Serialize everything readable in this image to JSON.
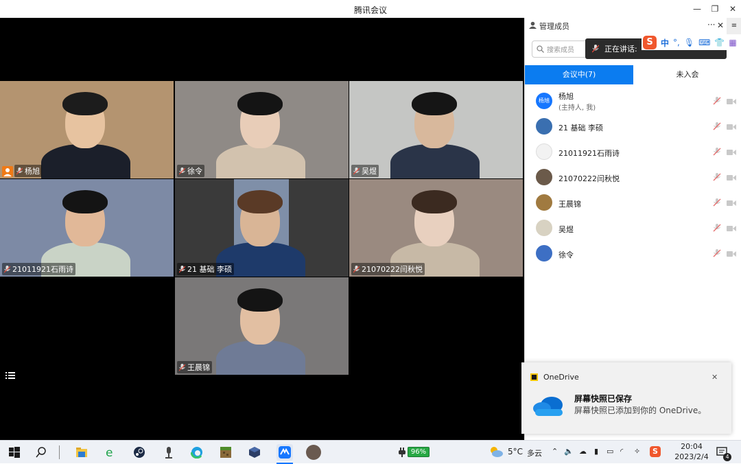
{
  "window": {
    "title": "腾讯会议"
  },
  "tiles": [
    {
      "name": "杨旭",
      "colors": {
        "bg": "#b49470",
        "skin": "#e7c3a0",
        "hair": "#1c1c1c",
        "cloth": "#1b1f2a"
      }
    },
    {
      "name": "徐令",
      "colors": {
        "bg": "#8f8a86",
        "skin": "#e8cdb8",
        "hair": "#141414",
        "cloth": "#d2c2ae"
      }
    },
    {
      "name": "吴煜",
      "colors": {
        "bg": "#c5c6c4",
        "skin": "#d8b89c",
        "hair": "#151515",
        "cloth": "#2a3448"
      }
    },
    {
      "name": "21011921石雨诗",
      "colors": {
        "bg": "#7d8aa5",
        "skin": "#e1b898",
        "hair": "#141414",
        "cloth": "#c9d3c6"
      }
    },
    {
      "name": "21 基础 李硕",
      "colors": {
        "bg": "#3a3a3a",
        "skin": "#d9b596",
        "hair": "#5a3a26",
        "cloth": "#1e3a6a"
      }
    },
    {
      "name": "21070222闫秋悦",
      "colors": {
        "bg": "#9a8a80",
        "skin": "#e8d0bf",
        "hair": "#3b2a20",
        "cloth": "#c7b9a6"
      }
    },
    {
      "name": "王晨锦",
      "colors": {
        "bg": "#7a7878",
        "skin": "#e2bfa2",
        "hair": "#141414",
        "cloth": "#6f7b96"
      }
    }
  ],
  "panel": {
    "title": "管理成员",
    "search_placeholder": "搜索成员",
    "speaking": "正在讲话:",
    "ime_label": "中",
    "tabs": [
      "会议中(7)",
      "未入会"
    ],
    "members": [
      {
        "name": "杨旭",
        "sub": "(主持人, 我)",
        "avatar_text": "杨旭",
        "color": "#1677ff"
      },
      {
        "name": "21 基础 李硕",
        "sub": "",
        "avatar_text": "",
        "color": "#3a6fb0"
      },
      {
        "name": "21011921石雨诗",
        "sub": "",
        "avatar_text": "",
        "color": "#f2f2f2"
      },
      {
        "name": "21070222闫秋悦",
        "sub": "",
        "avatar_text": "",
        "color": "#6b5a4a"
      },
      {
        "name": "王晨锦",
        "sub": "",
        "avatar_text": "",
        "color": "#a07a40"
      },
      {
        "name": "吴煜",
        "sub": "",
        "avatar_text": "",
        "color": "#d8d2c2"
      },
      {
        "name": "徐令",
        "sub": "",
        "avatar_text": "",
        "color": "#3d6fc4"
      }
    ]
  },
  "toast": {
    "app": "OneDrive",
    "title": "屏幕快照已保存",
    "body": "屏幕快照已添加到你的 OneDrive。"
  },
  "taskbar": {
    "battery": "96%",
    "weather_temp": "5°C",
    "weather_desc": "多云",
    "time": "20:04",
    "date": "2023/2/4",
    "notifications": "4"
  }
}
